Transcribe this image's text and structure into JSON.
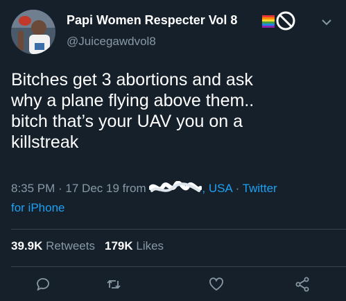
{
  "author": {
    "display_name": "Papi Women Respecter Vol 8",
    "handle": "@Juicegawdvol8"
  },
  "icons": [
    "avatar-photo",
    "rainbow-flag-icon",
    "prohibited-icon",
    "chevron-down-icon",
    "reply-icon",
    "retweet-icon",
    "like-icon",
    "share-icon"
  ],
  "tweet": {
    "lines": [
      "Bitches get 3 abortions and ask",
      "why a plane flying above them..",
      "bitch that’s your UAV you on a",
      "killstreak"
    ]
  },
  "meta": {
    "time": "8:35 PM",
    "sep1": " · ",
    "date": "17 Dec 19",
    "from": " from ",
    "location_suffix": ", USA",
    "sep2": " · ",
    "source_line1": "Twitter",
    "source_line2": "for iPhone"
  },
  "stats": {
    "retweets_count": "39.9K",
    "retweets_label": "Retweets",
    "likes_count": "179K",
    "likes_label": "Likes"
  },
  "colors": {
    "background": "#15202b",
    "secondary_text": "#8899a6",
    "link": "#1da1f2",
    "divider": "#38444d"
  }
}
